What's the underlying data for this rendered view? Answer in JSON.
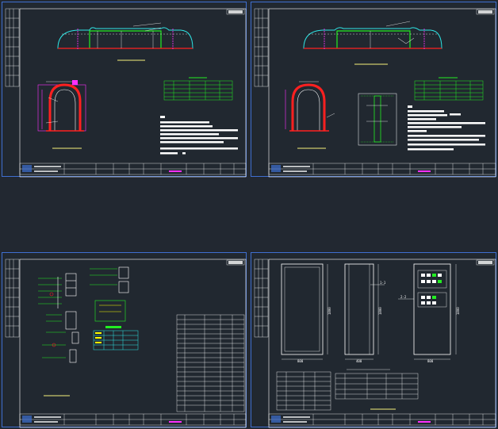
{
  "colors": {
    "background": "#222831",
    "sheet_background": "#212830",
    "sheet_border": "#3f6fd0",
    "line_white": "#ffffff",
    "line_green": "#22ee22",
    "line_red": "#ff2020",
    "line_cyan": "#2ee6e6",
    "line_magenta": "#ff30ff",
    "line_yellow": "#f5f07a",
    "line_blue": "#3f6fd0"
  },
  "sheets": [
    {
      "id": "sheet-1",
      "content": "tunnel cross-section and rebar detail"
    },
    {
      "id": "sheet-2",
      "content": "tunnel cross-section with reinforcement detail"
    },
    {
      "id": "sheet-3",
      "content": "electrical wiring schematic"
    },
    {
      "id": "sheet-4",
      "content": "distribution cabinet elevations"
    }
  ],
  "dimensions": {
    "cabinet_width_1": "800",
    "cabinet_height_1": "1800",
    "cabinet_width_2": "400",
    "cabinet_height_2": "1800",
    "cabinet_width_3": "800",
    "cabinet_height_3": "1800",
    "callout_1": "1-1",
    "callout_2": "2-2"
  }
}
